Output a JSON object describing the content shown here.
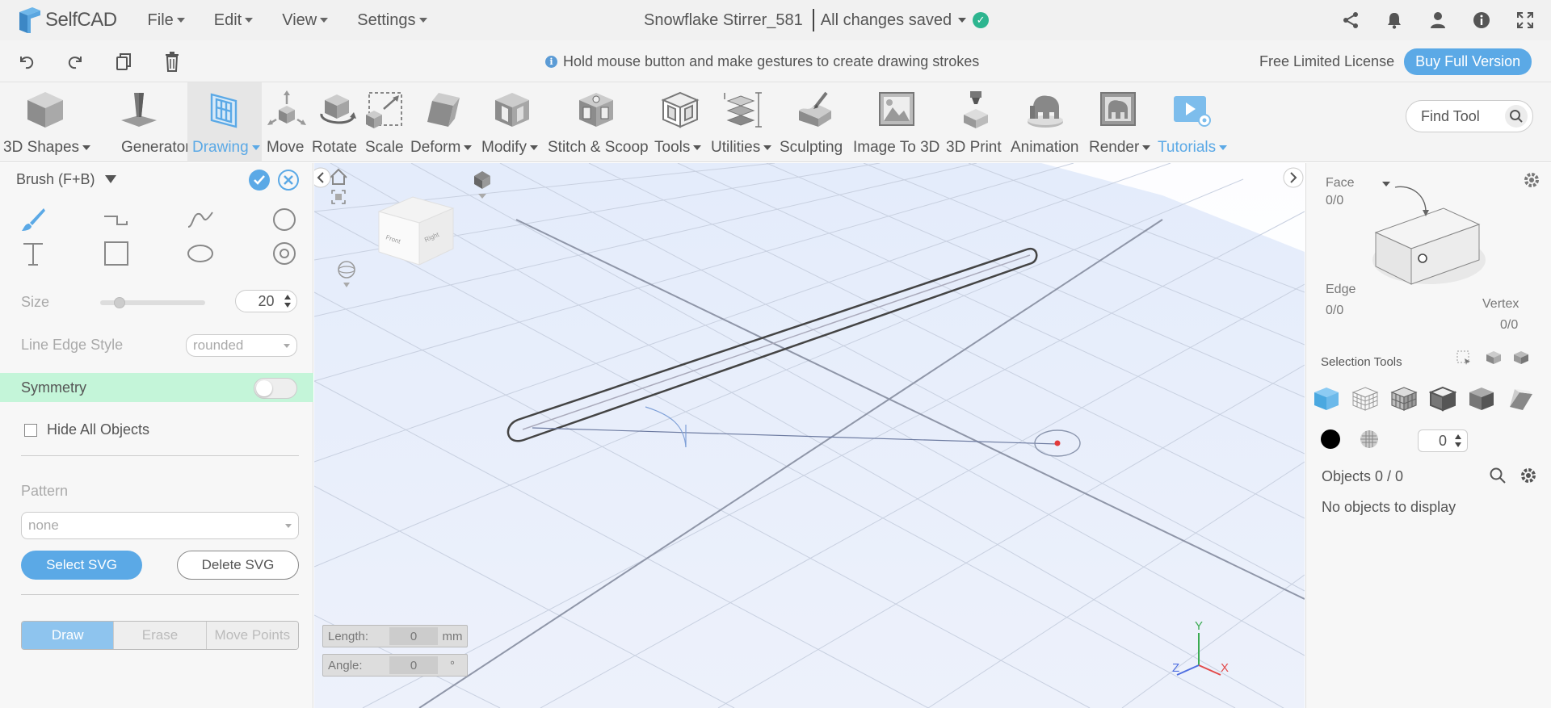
{
  "app": {
    "name": "SelfCAD"
  },
  "menu": [
    {
      "label": "File"
    },
    {
      "label": "Edit"
    },
    {
      "label": "View"
    },
    {
      "label": "Settings"
    }
  ],
  "document": {
    "title": "Snowflake Stirrer_581",
    "save_status": "All changes saved"
  },
  "hint": {
    "text": "Hold mouse button and make gestures to create drawing strokes"
  },
  "license": {
    "text": "Free Limited License",
    "buy_label": "Buy Full Version"
  },
  "tools": [
    {
      "label": "3D Shapes",
      "icon": "cube-icon",
      "dropdown": true
    },
    {
      "label": "Generators",
      "icon": "generator-icon",
      "dropdown": true
    },
    {
      "label": "Drawing",
      "icon": "drawing-icon",
      "dropdown": true,
      "active": true
    },
    {
      "label": "Move",
      "icon": "move-icon",
      "dropdown": false
    },
    {
      "label": "Rotate",
      "icon": "rotate-icon",
      "dropdown": false
    },
    {
      "label": "Scale",
      "icon": "scale-icon",
      "dropdown": false
    },
    {
      "label": "Deform",
      "icon": "deform-icon",
      "dropdown": true
    },
    {
      "label": "Modify",
      "icon": "modify-icon",
      "dropdown": true
    },
    {
      "label": "Stitch & Scoop",
      "icon": "stitch-scoop-icon",
      "dropdown": false
    },
    {
      "label": "Tools",
      "icon": "tools-icon",
      "dropdown": true
    },
    {
      "label": "Utilities",
      "icon": "utilities-icon",
      "dropdown": true
    },
    {
      "label": "Sculpting",
      "icon": "sculpting-icon",
      "dropdown": false
    },
    {
      "label": "Image To 3D",
      "icon": "image-to-3d-icon",
      "dropdown": false
    },
    {
      "label": "3D Print",
      "icon": "3d-print-icon",
      "dropdown": false
    },
    {
      "label": "Animation",
      "icon": "animation-icon",
      "dropdown": false
    },
    {
      "label": "Render",
      "icon": "render-icon",
      "dropdown": true
    },
    {
      "label": "Tutorials",
      "icon": "tutorials-icon",
      "dropdown": true,
      "highlight": true
    }
  ],
  "find_tool": {
    "placeholder": "Find Tool"
  },
  "brush_panel": {
    "title": "Brush (F+B)",
    "size_label": "Size",
    "size_value": "20",
    "size_slider_fraction": 0.15,
    "line_edge_label": "Line Edge Style",
    "line_edge_value": "rounded",
    "symmetry_label": "Symmetry",
    "symmetry_on": false,
    "hide_all_label": "Hide All Objects",
    "pattern_label": "Pattern",
    "pattern_value": "none",
    "select_svg_label": "Select SVG",
    "delete_svg_label": "Delete SVG",
    "modes": [
      "Draw",
      "Erase",
      "Move Points"
    ],
    "active_mode": "Draw"
  },
  "viewcube": {
    "front": "Front",
    "right": "Right"
  },
  "readouts": {
    "length_label": "Length:",
    "length_value": "0",
    "length_unit": "mm",
    "angle_label": "Angle:",
    "angle_value": "0",
    "angle_unit": "°"
  },
  "axes": {
    "x": "X",
    "y": "Y",
    "z": "Z"
  },
  "selection": {
    "face_label": "Face",
    "face_count": "0/0",
    "edge_label": "Edge",
    "edge_count": "0/0",
    "vertex_label": "Vertex",
    "vertex_count": "0/0",
    "tools_label": "Selection Tools",
    "number_value": "0"
  },
  "objects": {
    "label": "Objects 0 / 0",
    "empty_text": "No objects to display"
  },
  "colors": {
    "accent": "#5ba9e6",
    "symmetry_bg": "#c4f5d9",
    "saved": "#2db58f",
    "select_blue": "#4aa8e0"
  }
}
